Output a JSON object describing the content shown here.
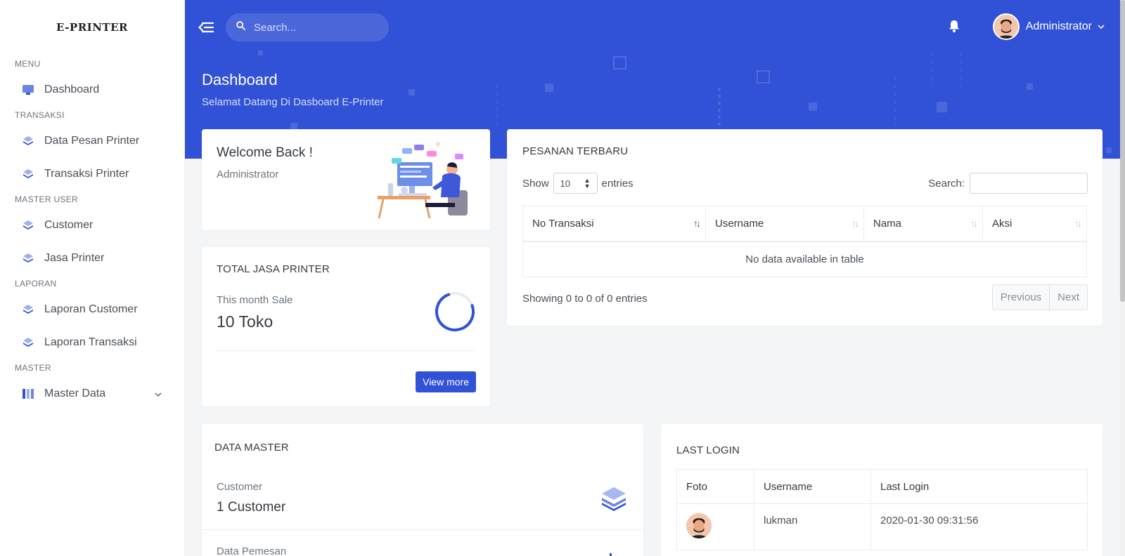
{
  "brand": "E-PRINTER",
  "sidebar": {
    "sections": [
      {
        "title": "MENU",
        "items": [
          {
            "label": "Dashboard",
            "icon": "monitor-icon"
          }
        ]
      },
      {
        "title": "TRANSAKSI",
        "items": [
          {
            "label": "Data Pesan Printer",
            "icon": "layers-icon"
          },
          {
            "label": "Transaksi Printer",
            "icon": "layers-icon"
          }
        ]
      },
      {
        "title": "MASTER USER",
        "items": [
          {
            "label": "Customer",
            "icon": "layers-icon"
          },
          {
            "label": "Jasa Printer",
            "icon": "layers-icon"
          }
        ]
      },
      {
        "title": "LAPORAN",
        "items": [
          {
            "label": "Laporan Customer",
            "icon": "layers-icon"
          },
          {
            "label": "Laporan Transaksi",
            "icon": "layers-icon"
          }
        ]
      },
      {
        "title": "MASTER",
        "items": [
          {
            "label": "Master Data",
            "icon": "columns-icon"
          }
        ]
      }
    ]
  },
  "topbar": {
    "search_placeholder": "Search...",
    "user_name": "Administrator"
  },
  "header": {
    "title": "Dashboard",
    "subtitle": "Selamat Datang Di Dasboard E-Printer"
  },
  "welcome": {
    "title": "Welcome Back !",
    "role": "Administrator"
  },
  "total_jasa": {
    "title": "TOTAL JASA PRINTER",
    "label": "This month Sale",
    "value": "10 Toko",
    "progress": 0.75,
    "button": "View more"
  },
  "pesanan": {
    "title": "PESANAN TERBARU",
    "show_label": "Show",
    "entries_label": "entries",
    "length_value": "10",
    "search_label": "Search:",
    "columns": [
      "No Transaksi",
      "Username",
      "Nama",
      "Aksi"
    ],
    "empty_text": "No data available in table",
    "info": "Showing 0 to 0 of 0 entries",
    "prev": "Previous",
    "next": "Next"
  },
  "master": {
    "title": "DATA MASTER",
    "items": [
      {
        "label": "Customer",
        "value": "1 Customer"
      },
      {
        "label": "Data Pemesan",
        "value": ""
      }
    ]
  },
  "last_login": {
    "title": "LAST LOGIN",
    "columns": [
      "Foto",
      "Username",
      "Last Login"
    ],
    "rows": [
      {
        "username": "lukman",
        "last_login": "2020-01-30 09:31:56"
      }
    ]
  },
  "colors": {
    "primary": "#3152d6",
    "background": "#f4f5f7"
  }
}
